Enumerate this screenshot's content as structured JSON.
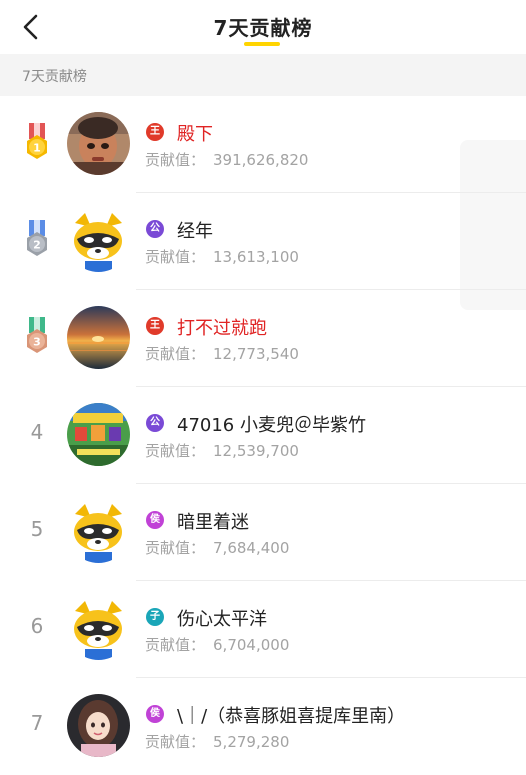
{
  "header": {
    "title": "7天贡献榜"
  },
  "section_label": "7天贡献榜",
  "contrib_label": "贡献值：",
  "rows": [
    {
      "rank": "1",
      "badge": "王",
      "badge_color": "#e03a2a",
      "name": "殿下",
      "name_color": "red",
      "value": "391,626,820"
    },
    {
      "rank": "2",
      "badge": "公",
      "badge_color": "#7a4ad6",
      "name": "经年",
      "name_color": "normal",
      "value": "13,613,100"
    },
    {
      "rank": "3",
      "badge": "王",
      "badge_color": "#e03a2a",
      "name": "打不过就跑",
      "name_color": "red",
      "value": "12,773,540"
    },
    {
      "rank": "4",
      "badge": "公",
      "badge_color": "#7a4ad6",
      "name": "47016  小麦兜＠毕紫竹",
      "name_color": "normal",
      "value": "12,539,700"
    },
    {
      "rank": "5",
      "badge": "侯",
      "badge_color": "#c042d6",
      "name": "暗里着迷",
      "name_color": "normal",
      "value": "7,684,400"
    },
    {
      "rank": "6",
      "badge": "子",
      "badge_color": "#1aa6b8",
      "name": "伤心太平洋",
      "name_color": "normal",
      "value": "6,704,000"
    },
    {
      "rank": "7",
      "badge": "侯",
      "badge_color": "#c042d6",
      "name": "\\｜/（恭喜豚姐喜提库里南）",
      "name_color": "normal",
      "value": "5,279,280"
    }
  ]
}
